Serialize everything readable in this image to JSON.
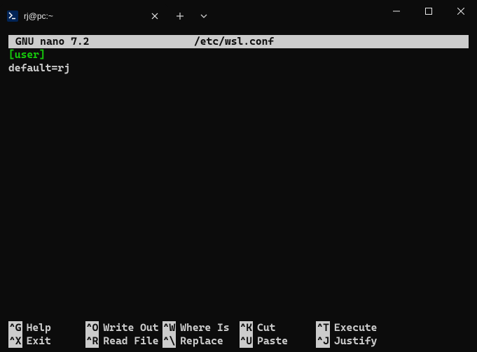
{
  "titlebar": {
    "tab_title": "rj@pc:~",
    "tab_icon_glyph": ">_"
  },
  "nano": {
    "app": "GNU nano 7.2",
    "file": "/etc/wsl.conf"
  },
  "content": {
    "line1": "[user]",
    "line2": "default=rj"
  },
  "shortcuts": {
    "row1": [
      {
        "key": "^G",
        "action": "Help"
      },
      {
        "key": "^O",
        "action": "Write Out"
      },
      {
        "key": "^W",
        "action": "Where Is"
      },
      {
        "key": "^K",
        "action": "Cut"
      },
      {
        "key": "^T",
        "action": "Execute"
      }
    ],
    "row2": [
      {
        "key": "^X",
        "action": "Exit"
      },
      {
        "key": "^R",
        "action": "Read File"
      },
      {
        "key": "^\\",
        "action": "Replace"
      },
      {
        "key": "^U",
        "action": "Paste"
      },
      {
        "key": "^J",
        "action": "Justify"
      }
    ]
  }
}
